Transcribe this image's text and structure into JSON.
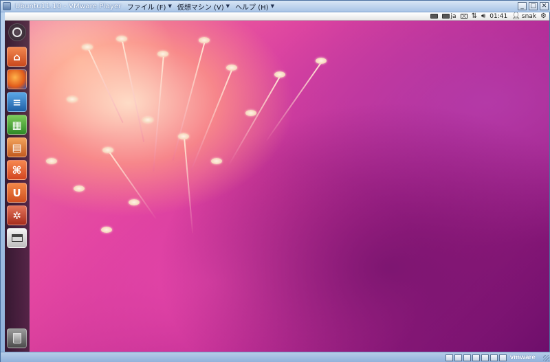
{
  "window": {
    "title": "Ubuntu11.10 - VMware Player",
    "menus": [
      {
        "label": "ファイル (F)"
      },
      {
        "label": "仮想マシン (V)"
      },
      {
        "label": "ヘルプ (H)"
      }
    ],
    "controls": {
      "minimize": "_",
      "maximize": "□",
      "close": "✕"
    }
  },
  "panel": {
    "keyboard_layout": "ja",
    "clock": "01:41",
    "user": "snak"
  },
  "launcher": {
    "items": [
      {
        "name": "dash",
        "icon": "ubuntu-logo-icon"
      },
      {
        "name": "home-folder",
        "icon": "home-folder-icon",
        "color": "#e2642e"
      },
      {
        "name": "firefox",
        "icon": "firefox-icon",
        "color": "#e96a22"
      },
      {
        "name": "libreoffice-writer",
        "icon": "writer-icon",
        "color": "#2f7dc4"
      },
      {
        "name": "libreoffice-calc",
        "icon": "calc-icon",
        "color": "#3f9e35"
      },
      {
        "name": "libreoffice-impress",
        "icon": "impress-icon",
        "color": "#d0612a"
      },
      {
        "name": "ubuntu-software-center",
        "icon": "software-center-icon",
        "color": "#e5542b"
      },
      {
        "name": "ubuntu-one",
        "icon": "ubuntu-one-icon",
        "color": "#e06428",
        "glyph": "U"
      },
      {
        "name": "system-settings",
        "icon": "system-settings-icon",
        "color": "#c8442a"
      },
      {
        "name": "workspace-switcher",
        "icon": "workspace-switcher-icon",
        "color": "#d9d9d9"
      },
      {
        "name": "trash",
        "icon": "trash-icon",
        "color": "#7b7b7b"
      }
    ]
  },
  "statusbar": {
    "logo_text": "vmware"
  }
}
